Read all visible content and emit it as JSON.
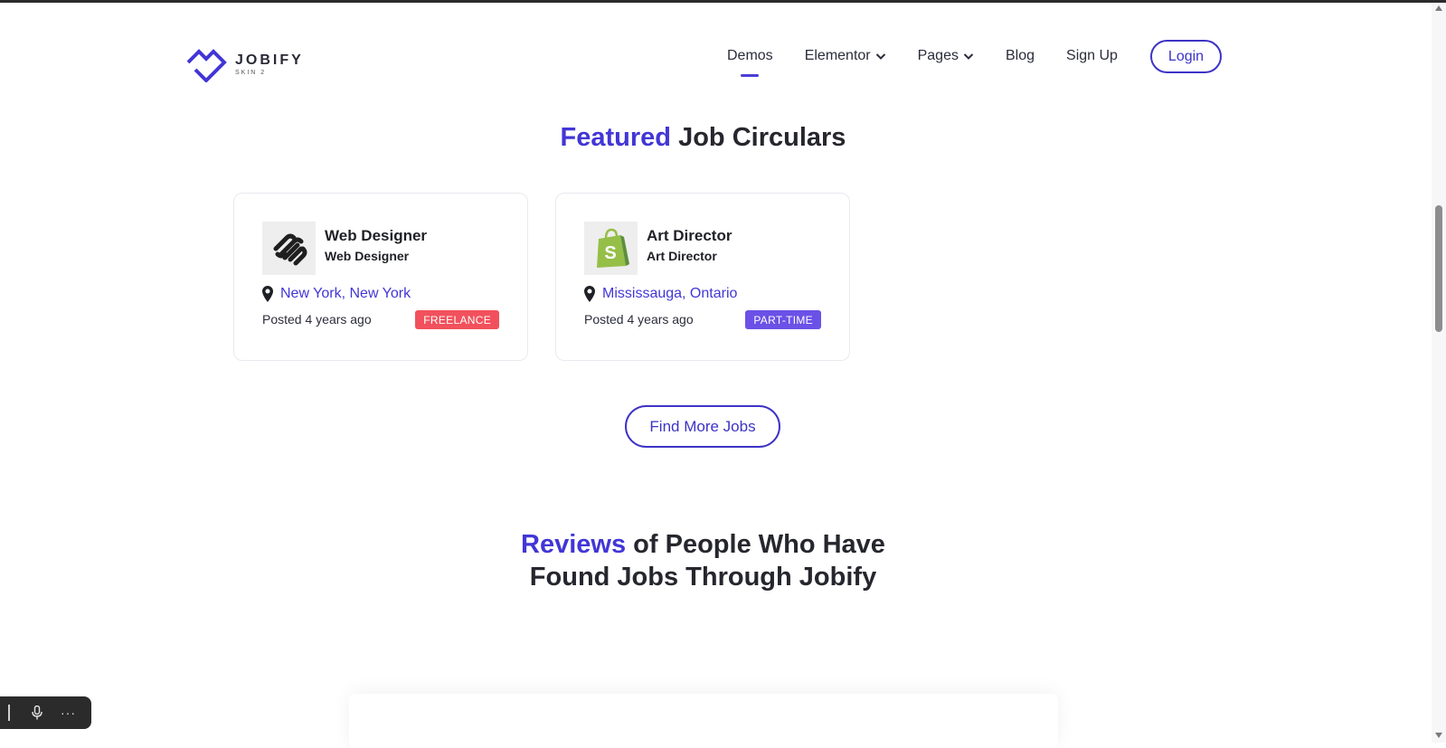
{
  "logo": {
    "name": "JOBIFY",
    "sub": "SKIN 2"
  },
  "nav": {
    "items": [
      {
        "label": "Demos"
      },
      {
        "label": "Elementor"
      },
      {
        "label": "Pages"
      },
      {
        "label": "Blog"
      },
      {
        "label": "Sign Up"
      }
    ],
    "login": "Login"
  },
  "featured": {
    "title_accent": "Featured",
    "title_rest": " Job Circulars",
    "jobs": [
      {
        "title": "Web Designer",
        "company": "Web Designer",
        "location": "New York, New York",
        "posted": "Posted 4 years ago",
        "badge": "FREELANCE",
        "logo_icon": "squarespace-logo-icon"
      },
      {
        "title": "Art Director",
        "company": "Art Director",
        "location": "Mississauga, Ontario",
        "posted": "Posted 4 years ago",
        "badge": "PART-TIME",
        "logo_icon": "shopify-logo-icon"
      }
    ],
    "more_button": "Find More Jobs"
  },
  "reviews": {
    "title_accent": "Reviews",
    "title_rest_line1": " of People Who Have",
    "title_line2": "Found Jobs Through Jobify"
  },
  "colors": {
    "accent": "#4236d6",
    "freelance_badge": "#f1515c",
    "parttime_badge": "#6b51e6"
  }
}
